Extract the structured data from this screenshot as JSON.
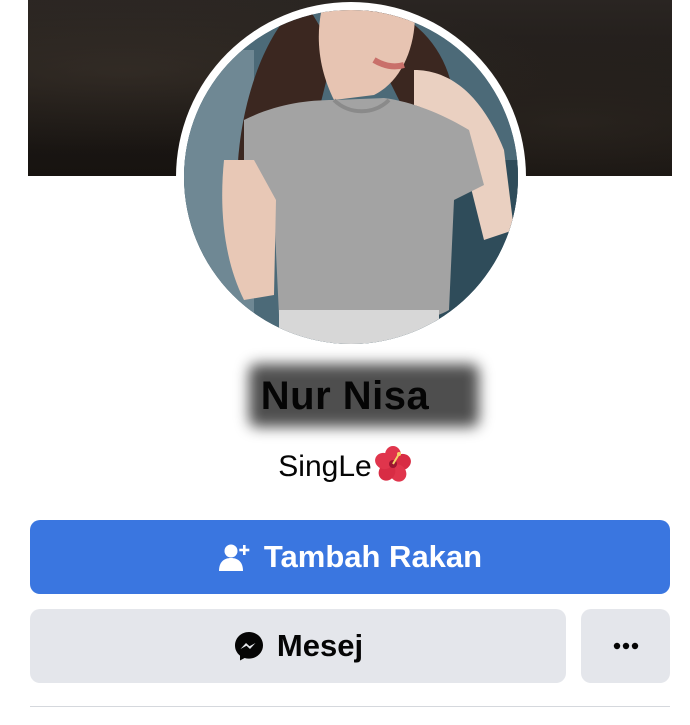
{
  "profile": {
    "name": "Nur Nisa",
    "bio": "SingLe",
    "bio_emoji": "hibiscus-icon"
  },
  "actions": {
    "add_friend_label": "Tambah Rakan",
    "message_label": "Mesej",
    "more_label": "•••"
  },
  "colors": {
    "primary_button": "#3a76e0",
    "secondary_button": "#e4e6eb",
    "text": "#050505"
  },
  "icons": {
    "add_friend": "add-friend-icon",
    "messenger": "messenger-icon",
    "more": "more-dots-icon"
  }
}
